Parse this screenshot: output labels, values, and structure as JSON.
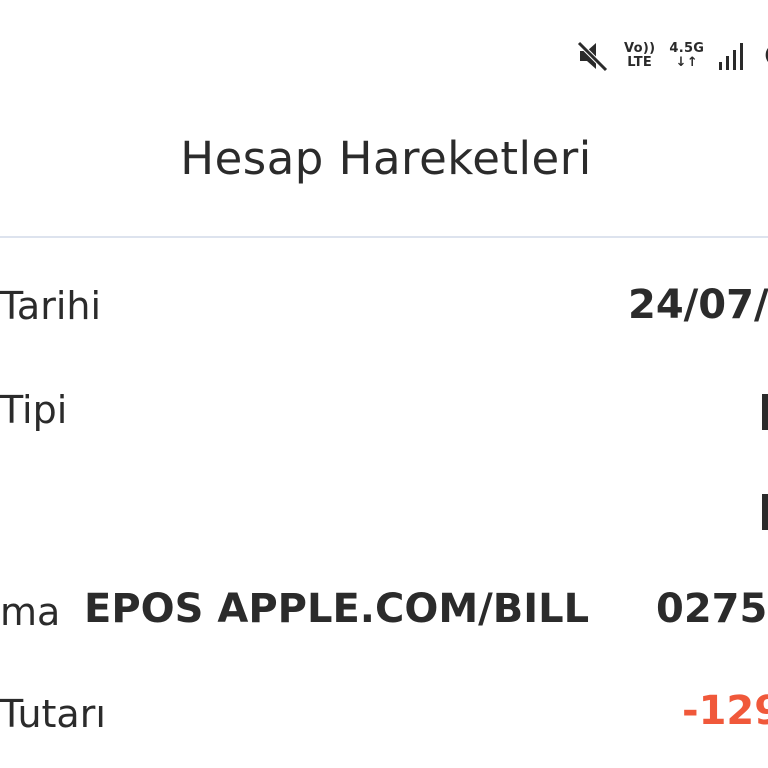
{
  "status_bar": {
    "volte_top": "Vo))",
    "volte_bottom": "LTE",
    "network_top": "4.5G",
    "network_bottom": "↓↑",
    "icons": [
      "mute-icon",
      "volte-icon",
      "network-4-5g-icon",
      "signal-icon",
      "battery-icon"
    ]
  },
  "header": {
    "title": "Hesap Hareketleri"
  },
  "details": {
    "date_label": "Tarihi",
    "date_value": "24/07/",
    "type_label": "Tipi",
    "description_label": "ma",
    "description_value": "EPOS APPLE.COM/BILL",
    "description_ref": "0275",
    "amount_label": "Tutarı",
    "amount_value": "-129"
  },
  "colors": {
    "negative_amount": "#f0583a",
    "divider": "#dde3ee",
    "text": "#2b2b2b"
  }
}
